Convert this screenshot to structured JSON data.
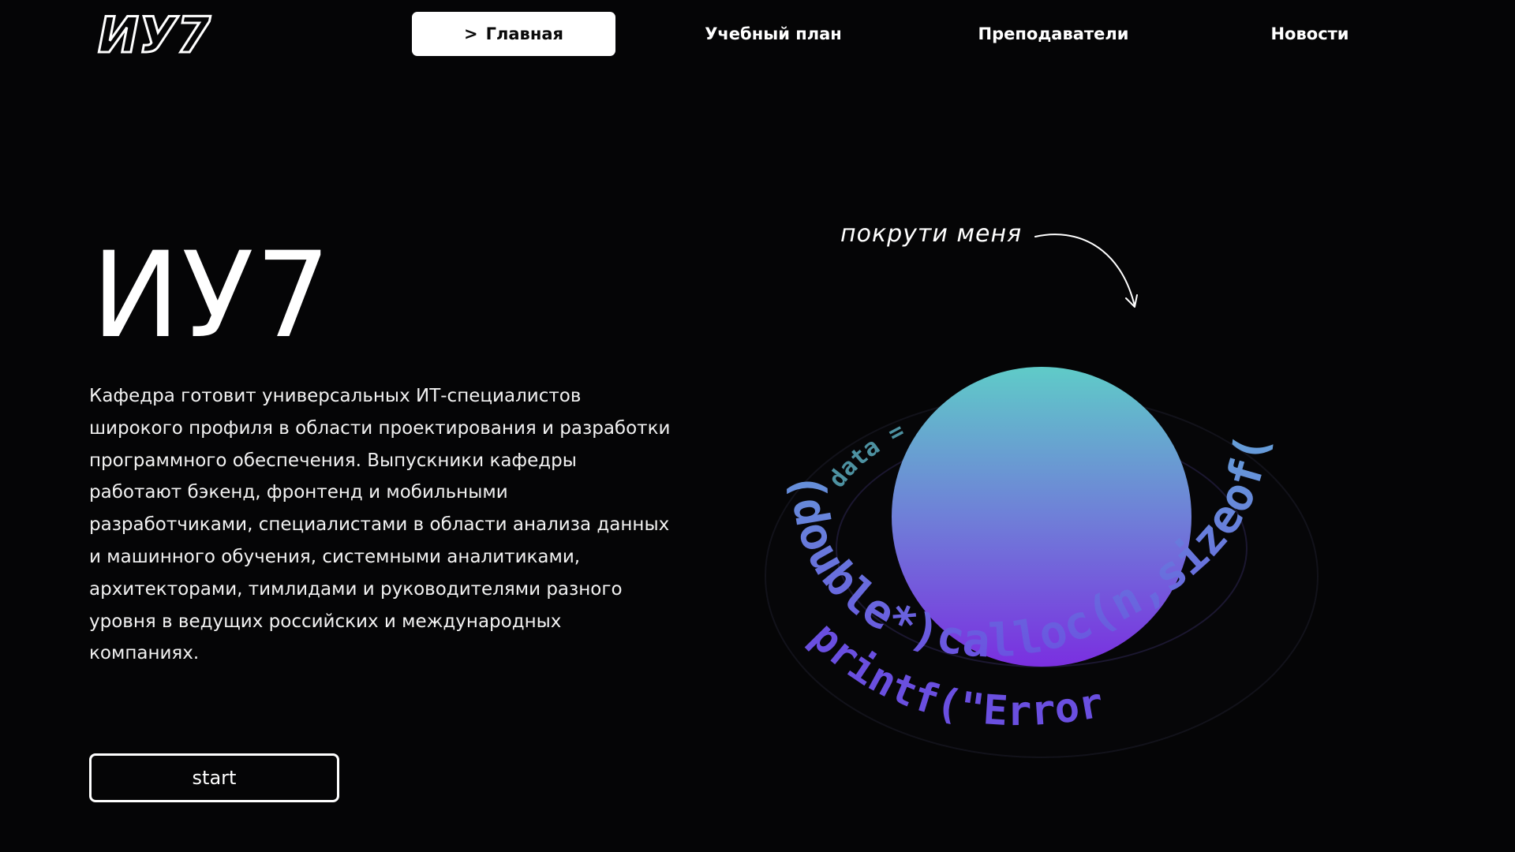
{
  "logo": {
    "text": "ИУ7"
  },
  "nav": {
    "items": [
      {
        "label": "Главная",
        "active": true,
        "marker": ">"
      },
      {
        "label": "Учебный план",
        "active": false
      },
      {
        "label": "Преподаватели",
        "active": false
      },
      {
        "label": "Новости",
        "active": false
      }
    ]
  },
  "hero": {
    "title": "ИУ7",
    "description": "Кафедра готовит универсальных ИТ-специалистов широкого профиля в области проектирования и разработки программного обеспечения. Выпускники кафедры работают бэкенд, фронтенд и мобильными разработчиками, специалистами в области анализа данных и машинного обучения, системными аналитиками, архитекторами, тимлидами и руководителями разного уровня в ведущих российских и международных компаниях.",
    "start_label": "start"
  },
  "visual": {
    "hint": "покрути меня",
    "ring_text_front": "(double*)calloc(n,sizeof(doub",
    "ring_text_lower": "printf(\"Error",
    "ring_text_back": "data ="
  },
  "colors": {
    "background": "#050506",
    "sphere_top": "#5fcbc8",
    "sphere_bottom": "#7a2fe0",
    "ring_text": "#62c7d6"
  }
}
